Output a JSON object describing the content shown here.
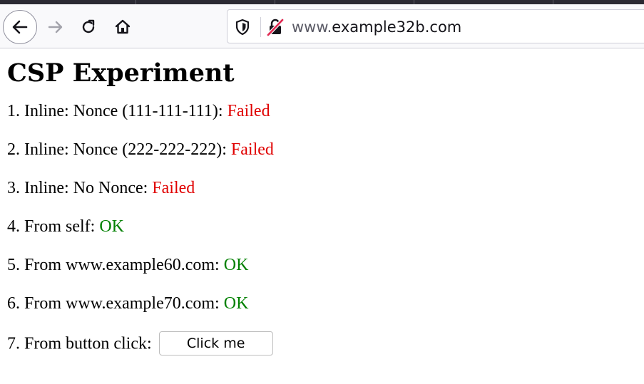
{
  "browser": {
    "url_prefix": "www.",
    "url_domain": "example32b.com"
  },
  "page": {
    "title": "CSP Experiment",
    "results": [
      {
        "label": "1. Inline: Nonce (111-111-111): ",
        "status": "Failed"
      },
      {
        "label": "2. Inline: Nonce (222-222-222): ",
        "status": "Failed"
      },
      {
        "label": "3. Inline: No Nonce: ",
        "status": "Failed"
      },
      {
        "label": "4. From self: ",
        "status": "OK"
      },
      {
        "label": "5. From www.example60.com: ",
        "status": "OK"
      },
      {
        "label": "6. From www.example70.com: ",
        "status": "OK"
      }
    ],
    "button_row": {
      "label": "7. From button click: ",
      "button_label": "Click me"
    }
  },
  "colors": {
    "failed": "#e00000",
    "ok": "#008000"
  }
}
